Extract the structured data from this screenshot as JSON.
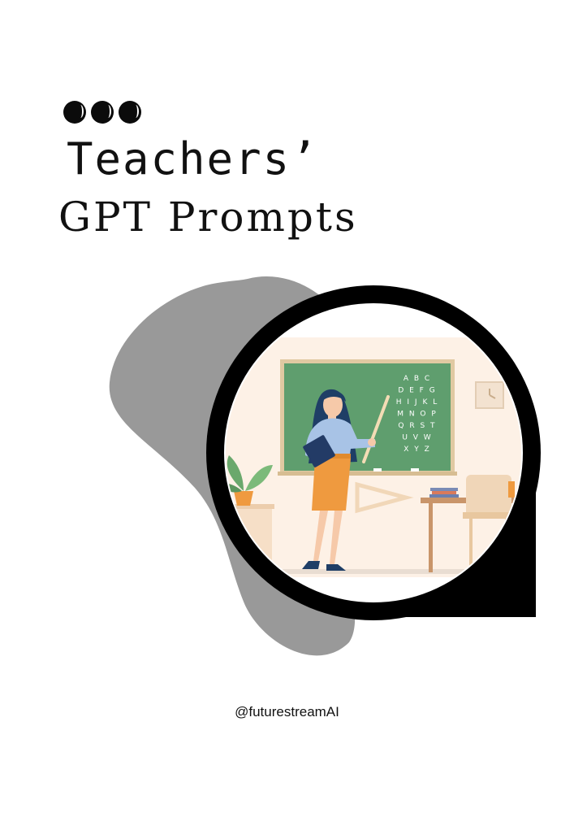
{
  "cover": {
    "title_line1": "Teachers’",
    "title_line2": "GPT Prompts",
    "handle": "@futurestreamAI"
  },
  "chalkboard": {
    "rows": [
      "A B C",
      "D E F G",
      "H I J K L",
      "M N O P",
      "Q R S T",
      "U V W",
      "X Y Z"
    ]
  },
  "colors": {
    "background": "#ffffff",
    "blob": "#999999",
    "lens_frame": "#000000",
    "board": "#5f9e6e",
    "board_frame": "#e0c9a2",
    "wall": "#fbeee2",
    "skirt": "#ef9a3f",
    "blouse": "#a8c3e6"
  }
}
